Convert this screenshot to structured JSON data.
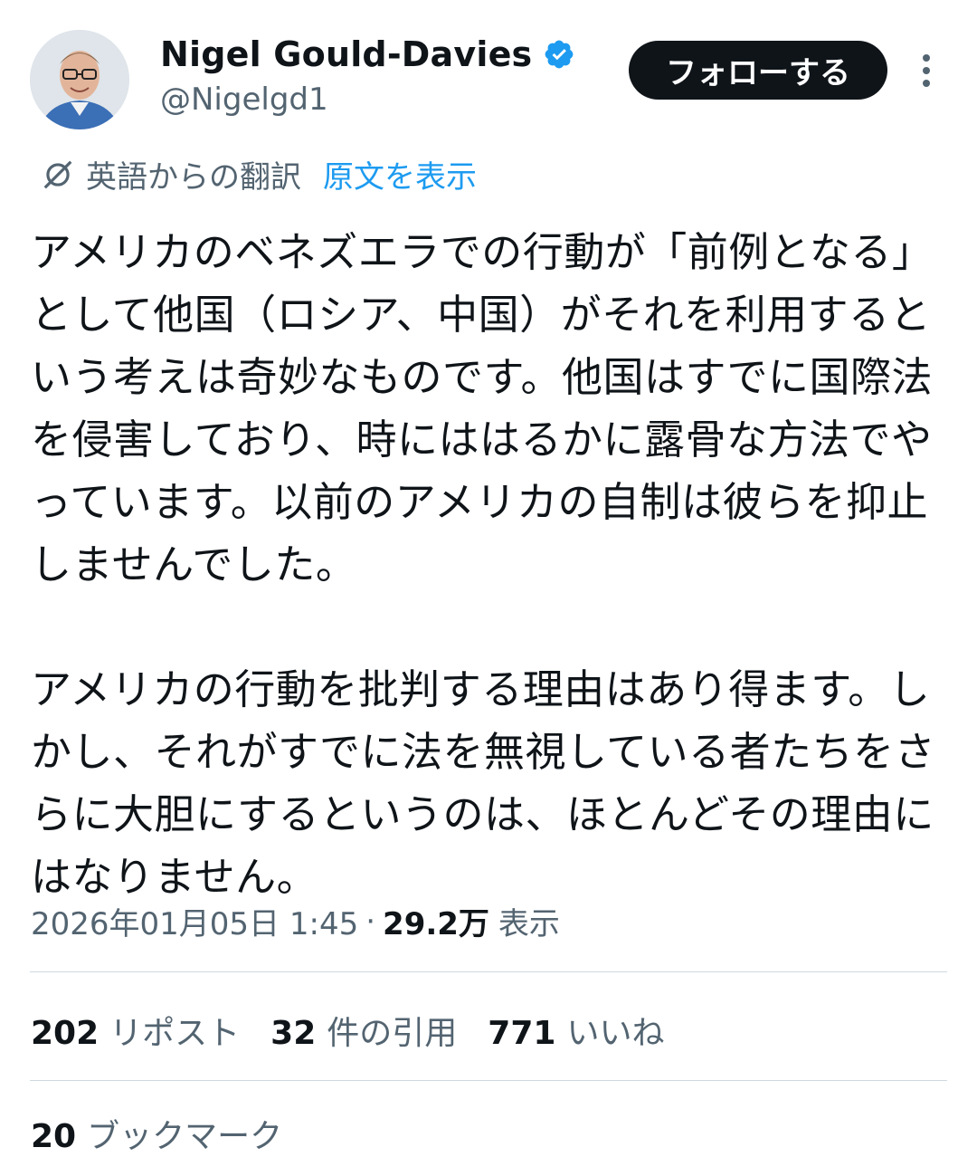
{
  "author": {
    "display_name": "Nigel Gould-Davies",
    "handle": "@Nigelgd1",
    "verified": true,
    "avatar_icon": "avatar-photo"
  },
  "actions": {
    "follow_label": "フォローする",
    "more_icon": "more-vertical-icon"
  },
  "translation": {
    "label": "英語からの翻訳",
    "show_original": "原文を表示"
  },
  "tweet": {
    "paragraph1": "アメリカのベネズエラでの行動が「前例となる」として他国（ロシア、中国）がそれを利用するという考えは奇妙なものです。他国はすでに国際法を侵害しており、時にははるかに露骨な方法でやっています。以前のアメリカの自制は彼らを抑止しませんでした。",
    "paragraph2": "アメリカの行動を批判する理由はあり得ます。しかし、それがすでに法を無視している者たちをさらに大胆にするというのは、ほとんどその理由にはなりません。"
  },
  "meta": {
    "timestamp": "2026年01月05日 1:45",
    "separator": "·",
    "views_count": "29.2万",
    "views_label": "表示"
  },
  "stats": {
    "reposts_count": "202",
    "reposts_label": "リポスト",
    "quotes_count": "32",
    "quotes_label": "件の引用",
    "likes_count": "771",
    "likes_label": "いいね"
  },
  "bookmarks": {
    "count": "20",
    "label": "ブックマーク"
  },
  "colors": {
    "text": "#0f1419",
    "secondary": "#536471",
    "accent": "#1d9bf0",
    "divider": "#cfd9de",
    "button_bg": "#0f1419"
  }
}
